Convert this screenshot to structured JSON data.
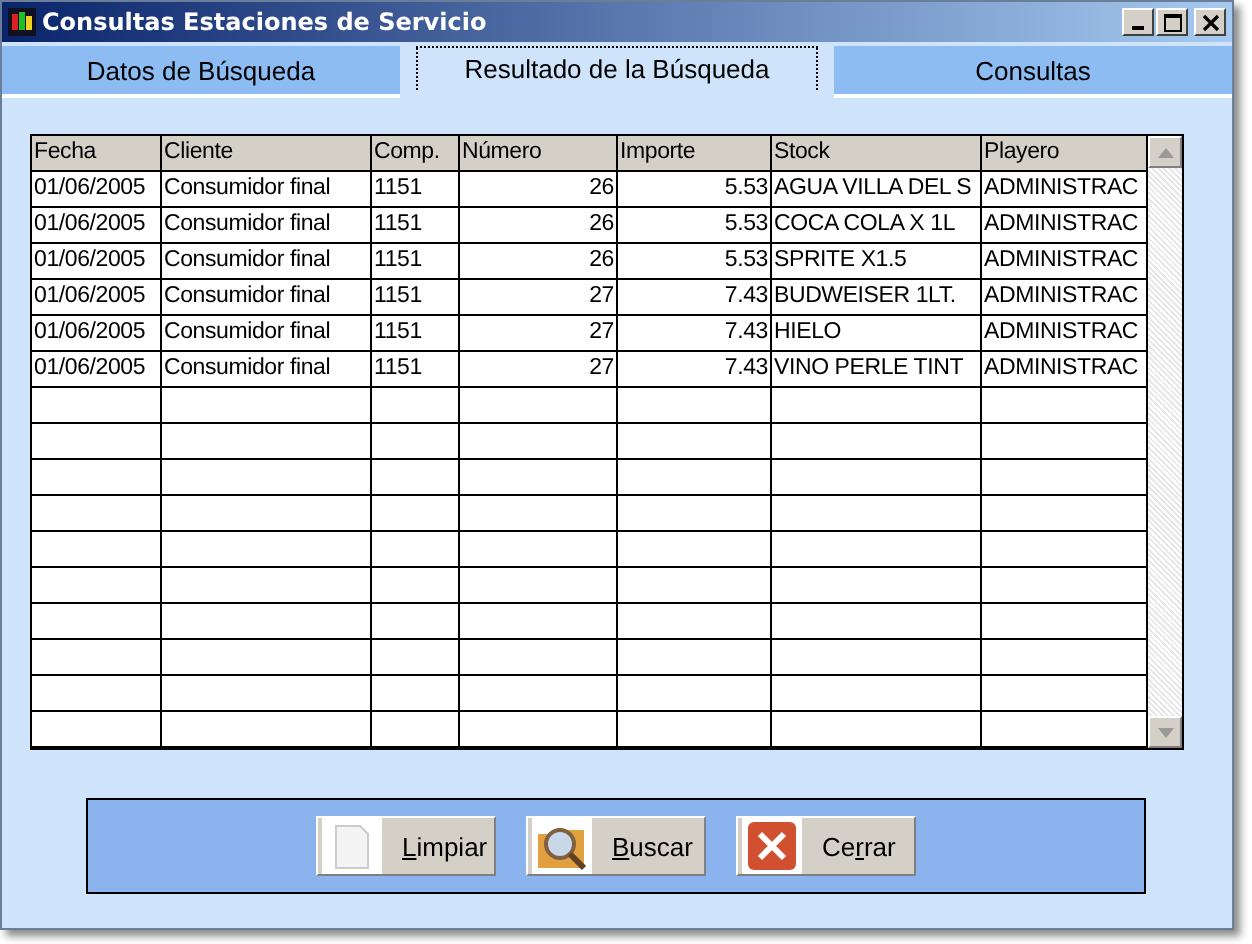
{
  "window": {
    "title": "Consultas Estaciones de Servicio"
  },
  "tabs": [
    {
      "label": "Datos de Búsqueda",
      "selected": false
    },
    {
      "label": "Resultado de la Búsqueda",
      "selected": true
    },
    {
      "label": "Consultas",
      "selected": false
    }
  ],
  "table": {
    "columns": [
      "Fecha",
      "Cliente",
      "Comp.",
      "Número",
      "Importe",
      "Stock",
      "Playero"
    ],
    "rows": [
      [
        "01/06/2005",
        "Consumidor final",
        "1151",
        "26",
        "5.53",
        "AGUA VILLA DEL S",
        "ADMINISTRAC"
      ],
      [
        "01/06/2005",
        "Consumidor final",
        "1151",
        "26",
        "5.53",
        "COCA COLA X 1L",
        "ADMINISTRAC"
      ],
      [
        "01/06/2005",
        "Consumidor final",
        "1151",
        "26",
        "5.53",
        "SPRITE X1.5",
        "ADMINISTRAC"
      ],
      [
        "01/06/2005",
        "Consumidor final",
        "1151",
        "27",
        "7.43",
        "BUDWEISER 1LT.",
        "ADMINISTRAC"
      ],
      [
        "01/06/2005",
        "Consumidor final",
        "1151",
        "27",
        "7.43",
        "HIELO",
        "ADMINISTRAC"
      ],
      [
        "01/06/2005",
        "Consumidor final",
        "1151",
        "27",
        "7.43",
        "VINO PERLE TINT",
        "ADMINISTRAC"
      ]
    ]
  },
  "buttons": [
    {
      "kind": "clear",
      "label_parts": [
        {
          "text": "L",
          "underlined": true
        },
        {
          "text": "impiar",
          "underlined": false
        }
      ]
    },
    {
      "kind": "search",
      "label_parts": [
        {
          "text": "B",
          "underlined": true
        },
        {
          "text": "uscar",
          "underlined": false
        }
      ]
    },
    {
      "kind": "close",
      "label_parts": [
        {
          "text": "Ce",
          "underlined": false
        },
        {
          "text": "r",
          "underlined": true
        },
        {
          "text": "rar",
          "underlined": false
        }
      ]
    }
  ]
}
